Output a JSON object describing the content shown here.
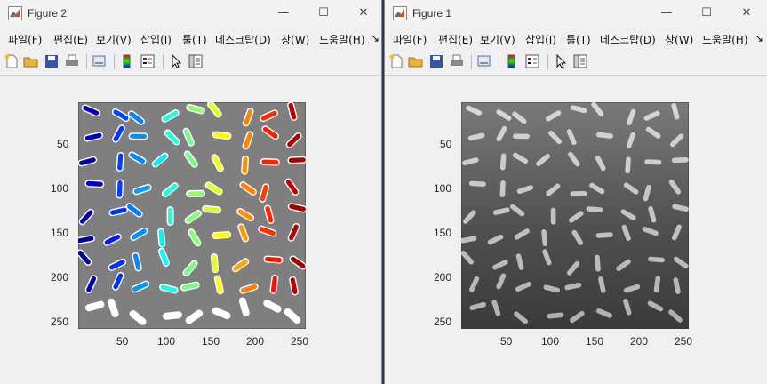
{
  "figure2": {
    "title": "Figure 2",
    "controls": {
      "minimize": "—",
      "maximize": "☐",
      "close": "✕"
    },
    "menu": [
      "파일(F)",
      "편집(E)",
      "보기(V)",
      "삽입(I)",
      "툴(T)",
      "데스크탑(D)",
      "창(W)",
      "도움말(H)"
    ],
    "menu_overflow": "↘",
    "toolbar_icons": [
      "new-figure-icon",
      "open-file-icon",
      "save-icon",
      "print-icon",
      "link-plot-icon",
      "colorbar-icon",
      "legend-icon",
      "pointer-icon",
      "property-inspector-icon"
    ],
    "axes": {
      "y_ticks": [
        "50",
        "100",
        "150",
        "200",
        "250"
      ],
      "x_ticks": [
        "50",
        "100",
        "150",
        "200",
        "250"
      ],
      "xlim": [
        0.5,
        256.5
      ],
      "ylim": [
        0.5,
        256.5
      ]
    },
    "image": "labeled rice grains, colormap jet on gray background"
  },
  "figure1": {
    "title": "Figure 1",
    "controls": {
      "minimize": "—",
      "maximize": "☐",
      "close": "✕"
    },
    "menu": [
      "파일(F)",
      "편집(E)",
      "보기(V)",
      "삽입(I)",
      "툴(T)",
      "데스크탑(D)",
      "창(W)",
      "도움말(H)"
    ],
    "menu_overflow": "↘",
    "toolbar_icons": [
      "new-figure-icon",
      "open-file-icon",
      "save-icon",
      "print-icon",
      "link-plot-icon",
      "colorbar-icon",
      "legend-icon",
      "pointer-icon",
      "property-inspector-icon"
    ],
    "axes": {
      "y_ticks": [
        "50",
        "100",
        "150",
        "200",
        "250"
      ],
      "x_ticks": [
        "50",
        "100",
        "150",
        "200",
        "250"
      ],
      "xlim": [
        0.5,
        256.5
      ],
      "ylim": [
        0.5,
        256.5
      ]
    },
    "image": "grayscale rice image"
  }
}
